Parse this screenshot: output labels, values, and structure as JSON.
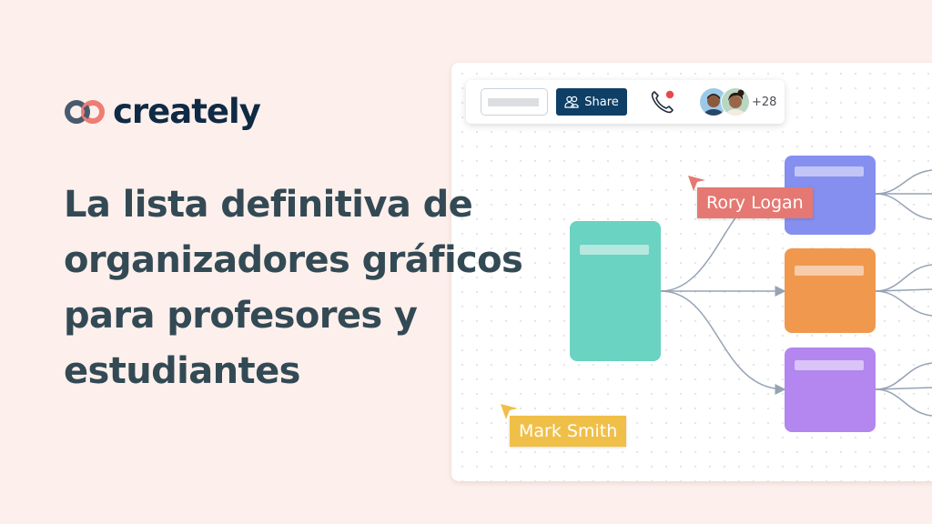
{
  "brand": {
    "logo_text": "creately",
    "logo_icon": "creately-rings-icon",
    "colors": {
      "ring_left": "#4a5a6e",
      "ring_right": "#ee7d74",
      "wordmark": "#0f2a44"
    }
  },
  "headline": {
    "lines": [
      "La lista definitiva de",
      "organizadores gráficos",
      "para profesores y",
      "estudiantes"
    ]
  },
  "toolbar": {
    "search_placeholder": "",
    "share_label": "Share",
    "share_icon": "users-icon",
    "call_icon": "phone-icon",
    "call_indicator_color": "#e8484a",
    "participants_extra": "+28",
    "avatars": [
      {
        "name": "participant-1",
        "bg": "#9dc9e8",
        "skin": "#8a5a3c",
        "shirt": "#284766"
      },
      {
        "name": "participant-2",
        "bg": "#b9d6c2",
        "skin": "#9a6648",
        "shirt": "#f4ece0"
      }
    ]
  },
  "diagram": {
    "nodes": [
      {
        "id": "root",
        "color": "#6ad3c1",
        "bar_color": "#b5e8df"
      },
      {
        "id": "child-top",
        "color": "#848ff0",
        "bar_color": "#c1c6f7"
      },
      {
        "id": "child-middle",
        "color": "#f0984e",
        "bar_color": "#f7ccaa"
      },
      {
        "id": "child-bottom",
        "color": "#b386f0",
        "bar_color": "#dac3f7"
      }
    ],
    "connector_color": "#95a3b5"
  },
  "cursors": [
    {
      "label": "Rory Logan",
      "color": "#e57872"
    },
    {
      "label": "Mark Smith",
      "color": "#f0bf48"
    }
  ],
  "colors": {
    "page_background": "#fdf0ec",
    "headline": "#334a55",
    "share_button": "#0e3f66"
  }
}
